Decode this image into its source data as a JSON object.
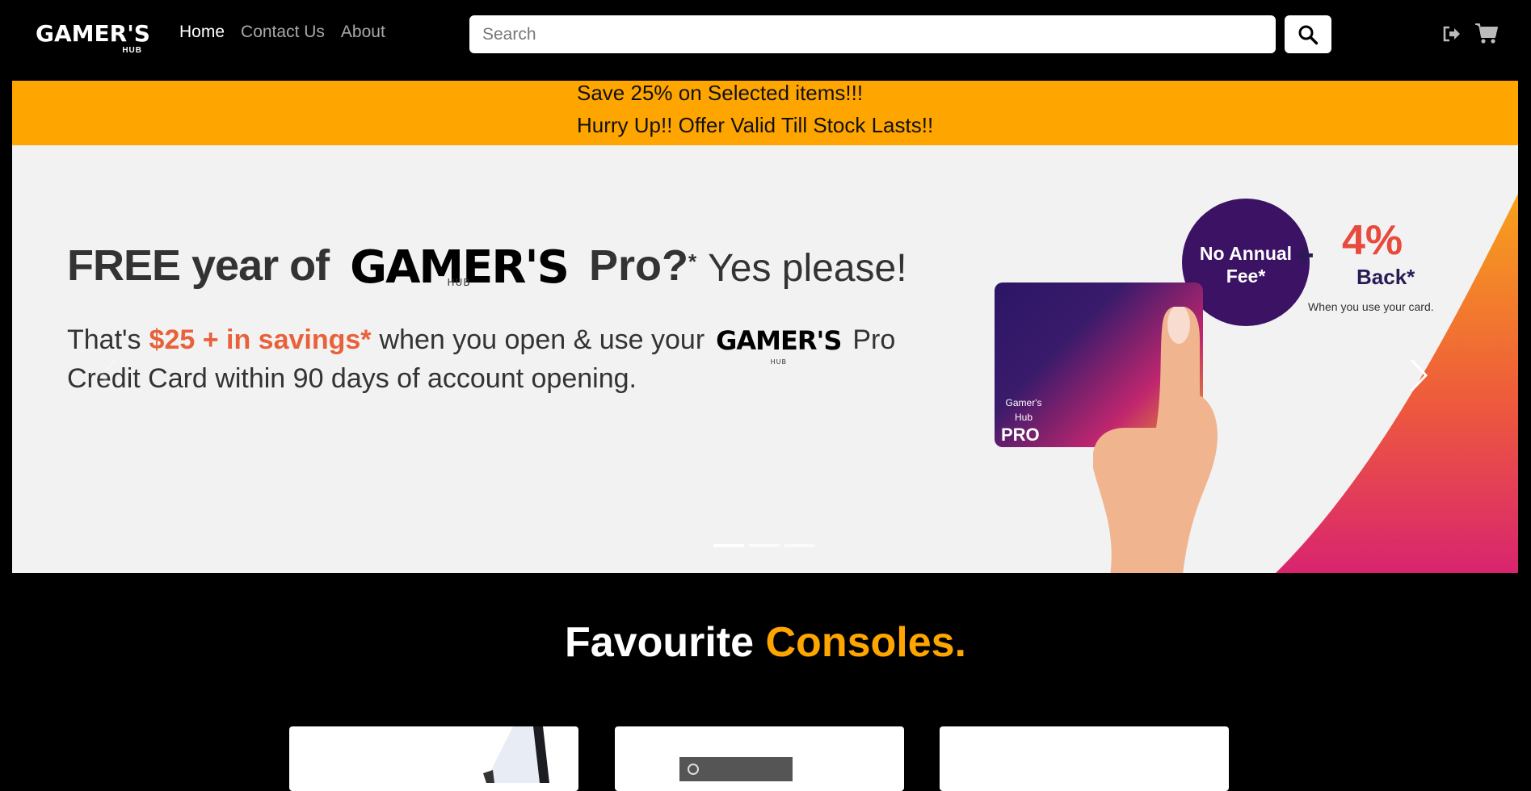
{
  "brand": {
    "logo": "GAMER'S",
    "logo_sub": "HUB"
  },
  "nav": {
    "items": [
      {
        "label": "Home",
        "active": true
      },
      {
        "label": "Contact Us",
        "active": false
      },
      {
        "label": "About",
        "active": false
      }
    ]
  },
  "search": {
    "placeholder": "Search",
    "value": ""
  },
  "header_icons": [
    "logout-icon",
    "cart-icon",
    "search-icon"
  ],
  "promo": {
    "line1": "Save 25% on Selected items!!!",
    "line2": "Hurry Up!! Offer Valid Till Stock Lasts!!"
  },
  "hero": {
    "line1_prefix": "FREE year of",
    "brand": "GAMER'S",
    "brand_sub": "HUB",
    "line1_pro": "Pro?",
    "star": "*",
    "line1_suffix": "Yes please!",
    "line2_prefix": "That's",
    "savings": "$25 + in savings*",
    "line2_mid": "when you open & use your",
    "line2_pro": "Pro",
    "line3": "Credit Card within 90 days of account opening.",
    "badge_text_1": "No Annual",
    "badge_text_2": "Fee*",
    "plus": "+",
    "percent": "4%",
    "back": "Back*",
    "when": "When you use your card.",
    "card_label_1": "Gamer's",
    "card_label_2": "Hub",
    "card_pro": "PRO",
    "slide_count": 3,
    "active_slide": 1
  },
  "section": {
    "title_white": "Favourite",
    "title_orange": "Consoles."
  },
  "colors": {
    "accent": "#ffa500",
    "background": "#000000",
    "savings": "#e8613a",
    "badge": "#3b1264"
  }
}
